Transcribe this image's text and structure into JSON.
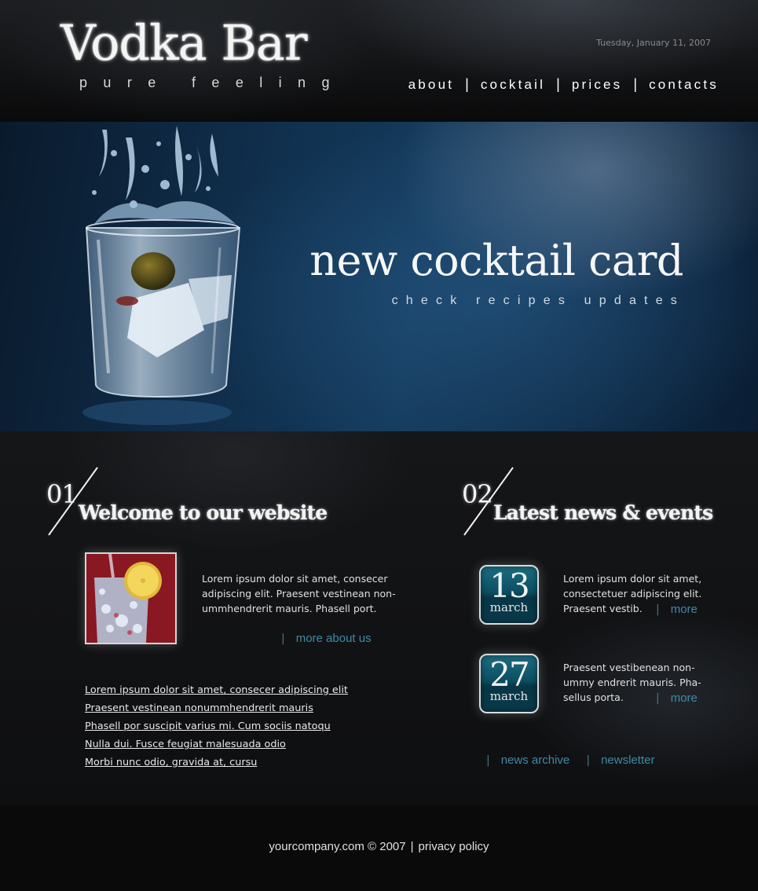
{
  "header": {
    "logo_title": "Vodka Bar",
    "logo_tagline": "pure feeling",
    "date": "Tuesday, January 11, 2007",
    "nav": [
      {
        "label": "about"
      },
      {
        "label": "cocktail"
      },
      {
        "label": "prices"
      },
      {
        "label": "contacts"
      }
    ],
    "nav_separator": "|"
  },
  "banner": {
    "heading": "new cocktail card",
    "subheading": "check recipes updates"
  },
  "welcome": {
    "number": "01",
    "title": "Welcome to our website",
    "body": "Lorem ipsum dolor sit amet, consecer adipiscing elit. Praesent vestinean non-ummhendrerit mauris. Phasell port.",
    "more_label": "more about us",
    "links": [
      "Lorem ipsum dolor sit amet, consecer adipiscing elit",
      "Praesent vestinean nonummhendrerit mauris",
      "Phasell por suscipit varius mi. Cum sociis natoqu",
      "Nulla dui. Fusce feugiat malesuada odio",
      "Morbi nunc odio, gravida at, cursu"
    ]
  },
  "news": {
    "number": "02",
    "title": "Latest news & events",
    "items": [
      {
        "day": "13",
        "month": "march",
        "text": "Lorem ipsum dolor sit amet, consectetuer adipiscing elit. Praesent vestib.",
        "more_label": "more"
      },
      {
        "day": "27",
        "month": "march",
        "text": "Praesent vestibenean non-ummy endrerit mauris. Pha-sellus porta.",
        "more_label": "more"
      }
    ],
    "archive_label": "news archive",
    "newsletter_label": "newsletter"
  },
  "footer": {
    "copyright": "yourcompany.com © 2007",
    "separator": "|",
    "privacy_label": "privacy policy"
  },
  "colors": {
    "accent_link": "#3f8aa5",
    "badge_teal": "#0c4e62",
    "background": "#0c0c0c"
  },
  "icons": {
    "section_divider": "diagonal-slash-icon"
  }
}
